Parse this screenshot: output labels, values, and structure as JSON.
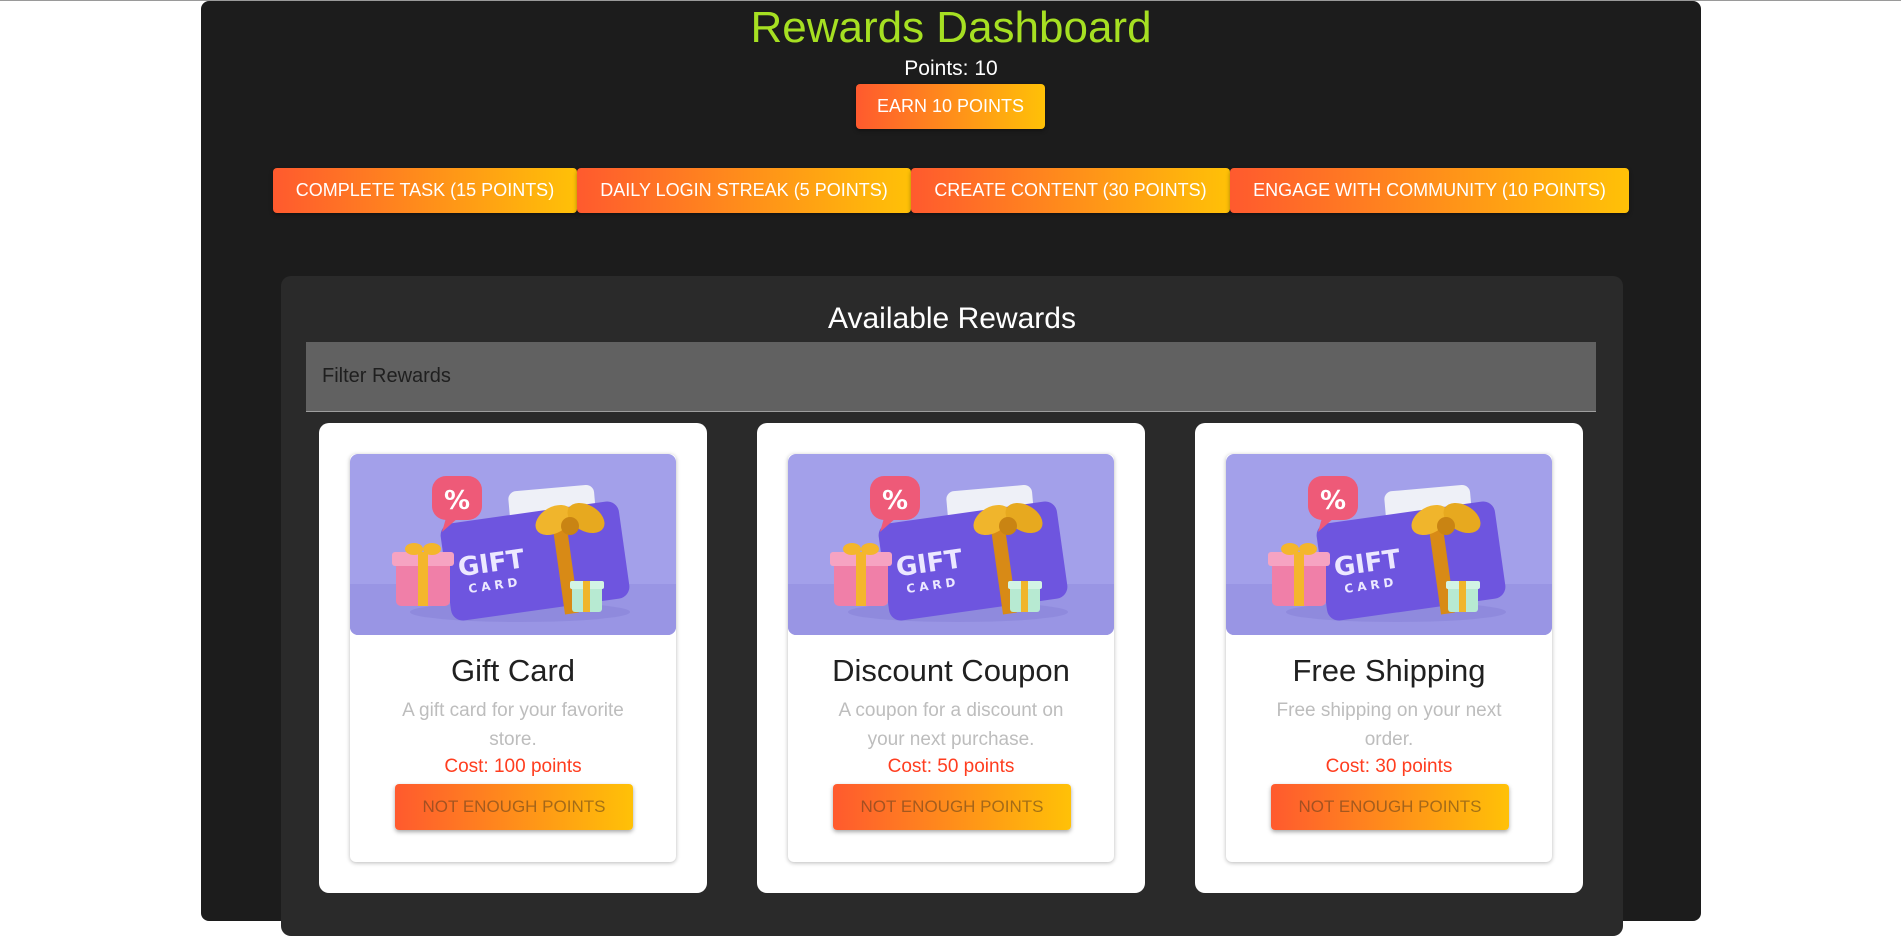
{
  "header": {
    "title": "Rewards Dashboard",
    "points_text": "Points: 10",
    "earn_label": "Earn 10 Points"
  },
  "tasks": [
    {
      "label": "Complete Task (15 Points)"
    },
    {
      "label": "Daily Login Streak (5 Points)"
    },
    {
      "label": "Create Content (30 Points)"
    },
    {
      "label": "Engage with Community (10 Points)"
    }
  ],
  "rewards": {
    "heading": "Available Rewards",
    "filter_placeholder": "Filter Rewards",
    "cards": [
      {
        "title": "Gift Card",
        "description": "A gift card for your favorite store.",
        "cost": "Cost: 100 points",
        "button": "Not Enough Points",
        "image_text_1": "GIFT",
        "image_text_2": "CARD",
        "image_badge": "%"
      },
      {
        "title": "Discount Coupon",
        "description": "A coupon for a discount on your next purchase.",
        "cost": "Cost: 50 points",
        "button": "Not Enough Points",
        "image_text_1": "GIFT",
        "image_text_2": "CARD",
        "image_badge": "%"
      },
      {
        "title": "Free Shipping",
        "description": "Free shipping on your next order.",
        "cost": "Cost: 30 points",
        "button": "Not Enough Points",
        "image_text_1": "GIFT",
        "image_text_2": "CARD",
        "image_badge": "%"
      }
    ]
  },
  "colors": {
    "title": "#a6e022",
    "app_background": "#1c1c1c",
    "panel_background": "#2a2a2a",
    "button_gradient_start": "#ff5a2e",
    "button_gradient_end": "#ffc107",
    "cost_text": "#ff3d1f"
  }
}
